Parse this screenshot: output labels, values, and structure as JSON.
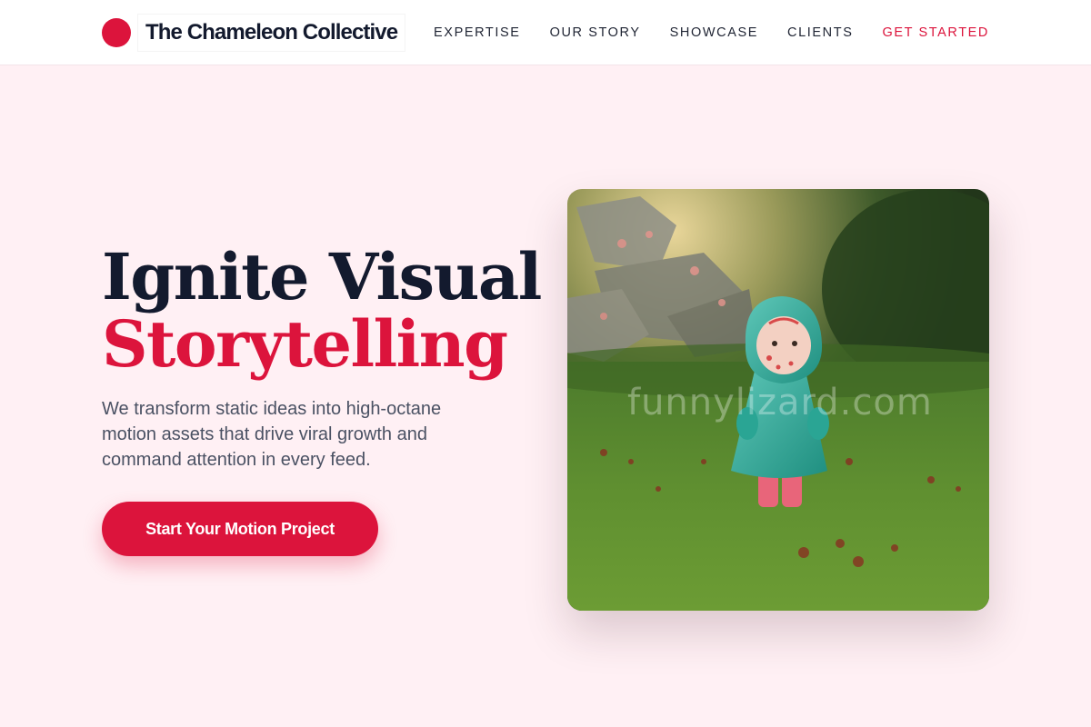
{
  "brand": {
    "name": "The Chameleon Collective",
    "accent_color": "#dc143c"
  },
  "nav": {
    "items": [
      {
        "label": "EXPERTISE"
      },
      {
        "label": "OUR STORY"
      },
      {
        "label": "SHOWCASE"
      },
      {
        "label": "CLIENTS"
      },
      {
        "label": "GET STARTED"
      }
    ]
  },
  "hero": {
    "title_line1": "Ignite Visual",
    "title_line2": "Storytelling",
    "description": "We transform static ideas into high-octane motion assets that drive viral growth and command attention in every feed.",
    "cta_label": "Start Your Motion Project"
  },
  "image": {
    "watermark": "funnylizard.com"
  },
  "colors": {
    "background": "#fff0f4",
    "heading_dark": "#131a2e",
    "accent": "#dc143c"
  }
}
